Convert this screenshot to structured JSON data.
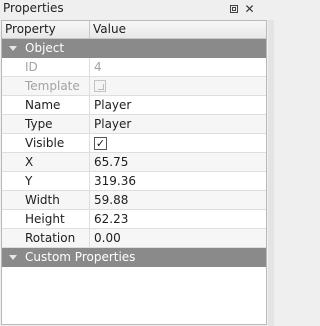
{
  "window": {
    "title": "Properties",
    "float_icon": "float-window-icon",
    "close_glyph": "✕"
  },
  "table": {
    "col_property": "Property",
    "col_value": "Value"
  },
  "groups": {
    "object": "Object",
    "custom": "Custom Properties"
  },
  "rows": {
    "id": {
      "label": "ID",
      "value": "4"
    },
    "template": {
      "label": "Template"
    },
    "name": {
      "label": "Name",
      "value": "Player"
    },
    "type": {
      "label": "Type",
      "value": "Player"
    },
    "visible": {
      "label": "Visible",
      "checked": true,
      "glyph": "✓"
    },
    "x": {
      "label": "X",
      "value": "65.75"
    },
    "y": {
      "label": "Y",
      "value": "319.36"
    },
    "width": {
      "label": "Width",
      "value": "59.88"
    },
    "height": {
      "label": "Height",
      "value": "62.23"
    },
    "rotation": {
      "label": "Rotation",
      "value": "0.00"
    }
  },
  "colors": {
    "group_bg": "#8a8a8a",
    "disabled_text": "#a3a3a3"
  }
}
